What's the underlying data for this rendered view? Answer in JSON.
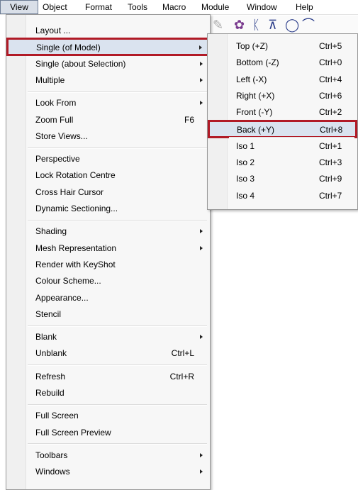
{
  "menubar": {
    "items": [
      "View",
      "Object",
      "Format",
      "Tools",
      "Macro",
      "Module",
      "Window",
      "Help"
    ]
  },
  "view_menu": {
    "groups": [
      [
        {
          "label": "Layout ...",
          "shortcut": "",
          "submenu": false
        },
        {
          "label": "Single (of Model)",
          "shortcut": "",
          "submenu": true,
          "highlighted": true
        },
        {
          "label": "Single (about Selection)",
          "shortcut": "",
          "submenu": true
        },
        {
          "label": "Multiple",
          "shortcut": "",
          "submenu": true
        }
      ],
      [
        {
          "label": "Look From",
          "shortcut": "",
          "submenu": true
        },
        {
          "label": "Zoom Full",
          "shortcut": "F6",
          "submenu": false
        },
        {
          "label": "Store Views...",
          "shortcut": "",
          "submenu": false
        }
      ],
      [
        {
          "label": "Perspective",
          "shortcut": "",
          "submenu": false
        },
        {
          "label": "Lock Rotation Centre",
          "shortcut": "",
          "submenu": false
        },
        {
          "label": "Cross Hair Cursor",
          "shortcut": "",
          "submenu": false
        },
        {
          "label": "Dynamic Sectioning...",
          "shortcut": "",
          "submenu": false
        }
      ],
      [
        {
          "label": "Shading",
          "shortcut": "",
          "submenu": true
        },
        {
          "label": "Mesh Representation",
          "shortcut": "",
          "submenu": true
        },
        {
          "label": "Render with KeyShot",
          "shortcut": "",
          "submenu": false
        },
        {
          "label": "Colour Scheme...",
          "shortcut": "",
          "submenu": false
        },
        {
          "label": "Appearance...",
          "shortcut": "",
          "submenu": false
        },
        {
          "label": "Stencil",
          "shortcut": "",
          "submenu": false
        }
      ],
      [
        {
          "label": "Blank",
          "shortcut": "",
          "submenu": true
        },
        {
          "label": "Unblank",
          "shortcut": "Ctrl+L",
          "submenu": false
        }
      ],
      [
        {
          "label": "Refresh",
          "shortcut": "Ctrl+R",
          "submenu": false
        },
        {
          "label": "Rebuild",
          "shortcut": "",
          "submenu": false
        }
      ],
      [
        {
          "label": "Full Screen",
          "shortcut": "",
          "submenu": false
        },
        {
          "label": "Full Screen Preview",
          "shortcut": "",
          "submenu": false
        }
      ],
      [
        {
          "label": "Toolbars",
          "shortcut": "",
          "submenu": true
        },
        {
          "label": "Windows",
          "shortcut": "",
          "submenu": true
        }
      ]
    ]
  },
  "single_submenu": {
    "groups": [
      [
        {
          "label": "Top (+Z)",
          "shortcut": "Ctrl+5"
        },
        {
          "label": "Bottom (-Z)",
          "shortcut": "Ctrl+0"
        },
        {
          "label": "Left (-X)",
          "shortcut": "Ctrl+4"
        },
        {
          "label": "Right (+X)",
          "shortcut": "Ctrl+6"
        },
        {
          "label": "Front (-Y)",
          "shortcut": "Ctrl+2"
        },
        {
          "label": "Back (+Y)",
          "shortcut": "Ctrl+8",
          "highlighted": true
        }
      ],
      [
        {
          "label": "Iso 1",
          "shortcut": "Ctrl+1"
        },
        {
          "label": "Iso 2",
          "shortcut": "Ctrl+3"
        },
        {
          "label": "Iso 3",
          "shortcut": "Ctrl+9"
        },
        {
          "label": "Iso 4",
          "shortcut": "Ctrl+7"
        }
      ]
    ]
  },
  "colors": {
    "highlight_outline": "#b11a26",
    "highlight_fill": "#dae3ef"
  },
  "toolbar_icons": [
    "toolbar-tool-icon-1",
    "toolbar-tool-icon-2",
    "toolbar-tool-icon-3",
    "toolbar-tool-icon-4",
    "toolbar-tool-icon-5",
    "toolbar-tool-icon-6"
  ]
}
